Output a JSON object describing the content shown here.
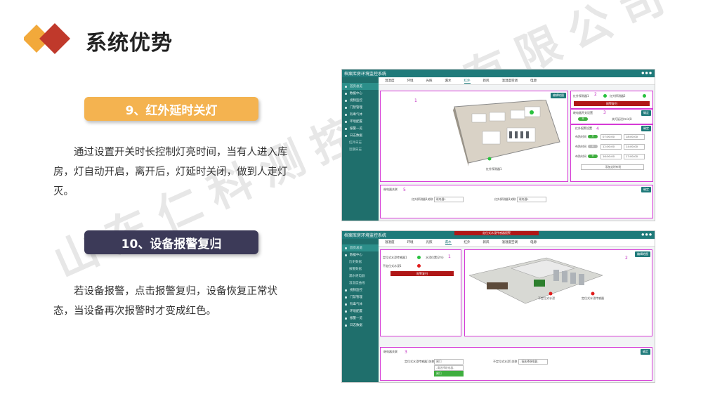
{
  "slide": {
    "title": "系统优势"
  },
  "sections": [
    {
      "badge": "9、红外延时关灯",
      "text": "通过设置开关时长控制灯亮时间，当有人进入库房，灯自动开启，离开后，灯延时关闭，做到人走灯灭。"
    },
    {
      "badge": "10、设备报警复归",
      "text": "若设备报警，点击报警复归，设备恢复正常状态，当设备再次报警时才变成红色。"
    }
  ],
  "watermark": "山东仁科测控技术有限公司",
  "screenshots": [
    {
      "app_title": "档案库房环境监控系统",
      "tabs": [
        "温湿度",
        "环境",
        "光照",
        "漏水",
        "红外",
        "新风",
        "温湿度空调",
        "电源"
      ],
      "active_tab": 4,
      "sidebar": [
        "首页总览",
        "数据中心",
        "视频监控",
        "门禁管理",
        "有毒气体",
        "环境配置",
        "报警一览",
        "日志数据",
        "红外日志",
        "近期日志"
      ],
      "numbers": [
        "1",
        "2",
        "3",
        "4",
        "5"
      ],
      "panel_labels": {
        "sensor1": "红外探测器1",
        "sensor2": "红外探测器2",
        "alarm_reset": "报警复归",
        "delay_title": "继电器开关设置",
        "delay_label": "关灯延迟(min)：",
        "delay_value": "1",
        "schedule_title": "红外报警设置",
        "save_btn": "添加定时布防",
        "bottom_title": "继电器关联",
        "bottom_label1": "红外探测器1关联",
        "bottom_label2": "红外探测器1关联",
        "bottom_val1": "继电器1",
        "bottom_val2": "继电器1",
        "confirm": "确定"
      },
      "schedule_rows": [
        {
          "label": "布防时间",
          "from": "07:00:00",
          "to": "18:00:00"
        },
        {
          "label": "布防时间",
          "from": "12:00:00",
          "to": "14:00:00"
        },
        {
          "label": "布防时间",
          "from": "16:00:00",
          "to": "17:00:00"
        }
      ],
      "device_label": "红外探测器1"
    },
    {
      "app_title": "档案库房环境监控系统",
      "alert": "定位式水浸传感器报警",
      "tabs": [
        "温湿度",
        "环境",
        "光照",
        "漏水",
        "红外",
        "新风",
        "温湿度空调",
        "电源"
      ],
      "active_tab": 3,
      "sidebar": [
        "首页总览",
        "数据中心",
        "历史数据",
        "报警数据",
        "漏水继电器",
        "温湿度曲线",
        "视频监控",
        "门禁管理",
        "有毒气体",
        "环境配置",
        "报警一览",
        "日志数据"
      ],
      "numbers": [
        "1",
        "2",
        "3"
      ],
      "panel_labels": {
        "sensor1": "定位式水浸传感器1",
        "sensor2": "不定位式水浸1",
        "distance": "水浸位置(2m)",
        "reset": "报警复归",
        "bottom_title": "继电器关联",
        "bottom_label1": "定位式水浸传感器1关联",
        "bottom_label2": "不定位式水浸1关联",
        "select1": "闸门",
        "select2": "-请选择继电器-",
        "dropdown": [
          "-请选择继电器-",
          "闸门"
        ],
        "confirm": "确定",
        "map_label1": "不定位式水浸",
        "map_label2": "定位式水浸传感器"
      }
    }
  ],
  "colors": {
    "pill1": "#f4b350",
    "pill2": "#3c3a58",
    "logo_orange": "#f2a93b",
    "logo_red": "#c0392b",
    "teal": "#1f7a7a"
  }
}
